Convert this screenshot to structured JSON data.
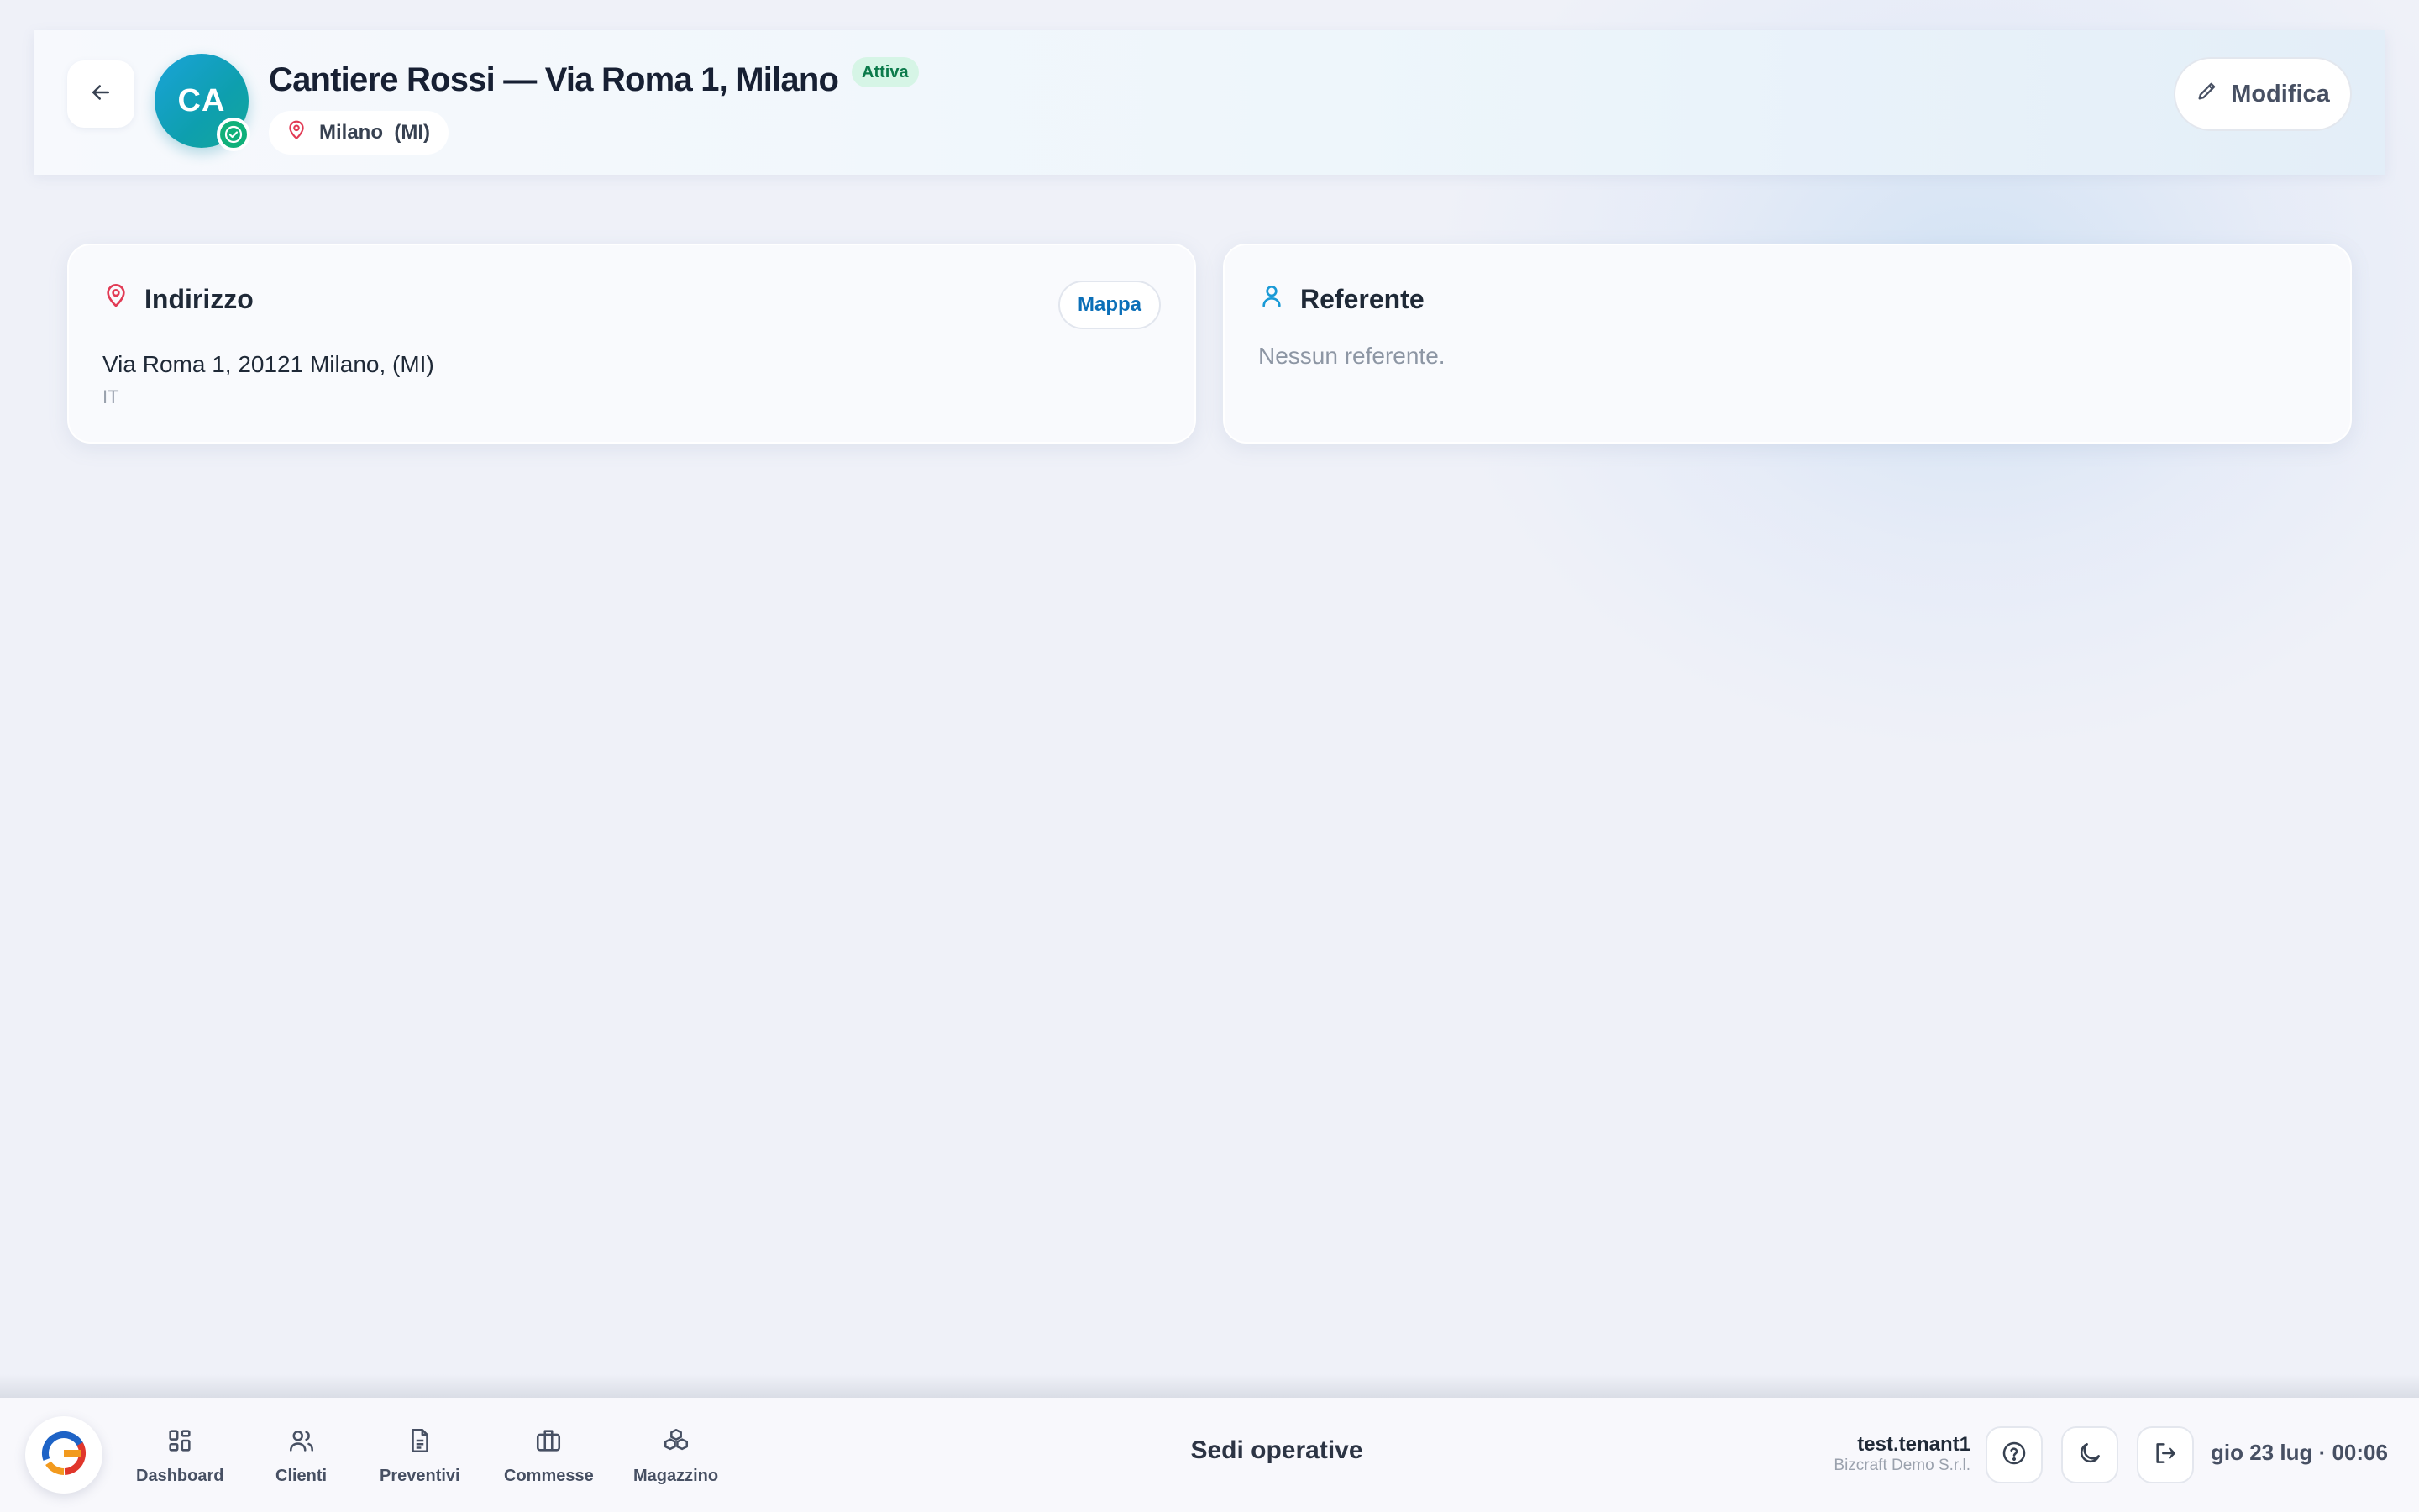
{
  "header": {
    "back_icon": "arrow-left-icon",
    "avatar_initials": "CA",
    "title": "Cantiere Rossi — Via Roma 1, Milano",
    "status": "Attiva",
    "location": "Milano  (MI)",
    "edit_label": "Modifica"
  },
  "address_card": {
    "title": "Indirizzo",
    "map_label": "Mappa",
    "line": "Via Roma 1, 20121 Milano, (MI)",
    "country": "IT"
  },
  "contact_card": {
    "title": "Referente",
    "empty": "Nessun referente."
  },
  "bottom_bar": {
    "nav": [
      {
        "label": "Dashboard",
        "icon": "grid-icon"
      },
      {
        "label": "Clienti",
        "icon": "users-icon"
      },
      {
        "label": "Preventivi",
        "icon": "document-icon"
      },
      {
        "label": "Commesse",
        "icon": "briefcase-icon"
      },
      {
        "label": "Magazzino",
        "icon": "boxes-icon"
      }
    ],
    "title": "Sedi operative",
    "user_name": "test.tenant1",
    "user_company": "Bizcraft Demo S.r.l.",
    "datetime": "gio 23 lug · 00:06"
  },
  "colors": {
    "accent": "#0b6fb8",
    "status_green": "#10b07a",
    "location_red": "#e23b55",
    "contact_blue": "#1a9ad6"
  }
}
